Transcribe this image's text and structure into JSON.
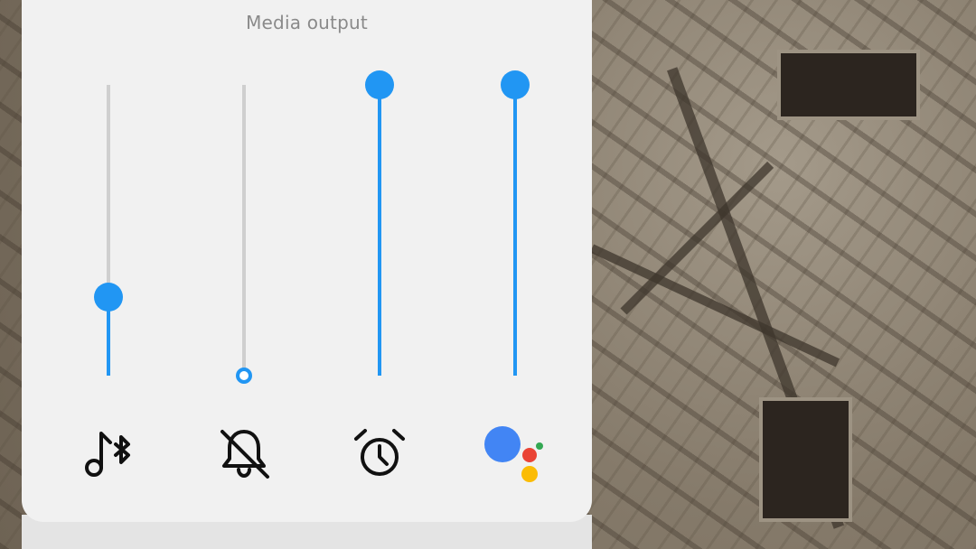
{
  "panel": {
    "title": "Media output"
  },
  "sliders": [
    {
      "id": "media",
      "level": 0.27,
      "muted": false,
      "icon": "bluetooth-music-icon"
    },
    {
      "id": "notification",
      "level": 0.0,
      "muted": true,
      "icon": "notifications-off-icon"
    },
    {
      "id": "alarm",
      "level": 1.0,
      "muted": false,
      "icon": "alarm-icon"
    },
    {
      "id": "assistant",
      "level": 1.0,
      "muted": false,
      "icon": "google-assistant-icon"
    }
  ],
  "colors": {
    "accent": "#2196f3",
    "track": "#cfcfcf",
    "panel": "#f1f1f1",
    "assistant_blue": "#4285f4",
    "assistant_red": "#ea4335",
    "assistant_yellow": "#fbbc05",
    "assistant_green": "#34a853"
  }
}
